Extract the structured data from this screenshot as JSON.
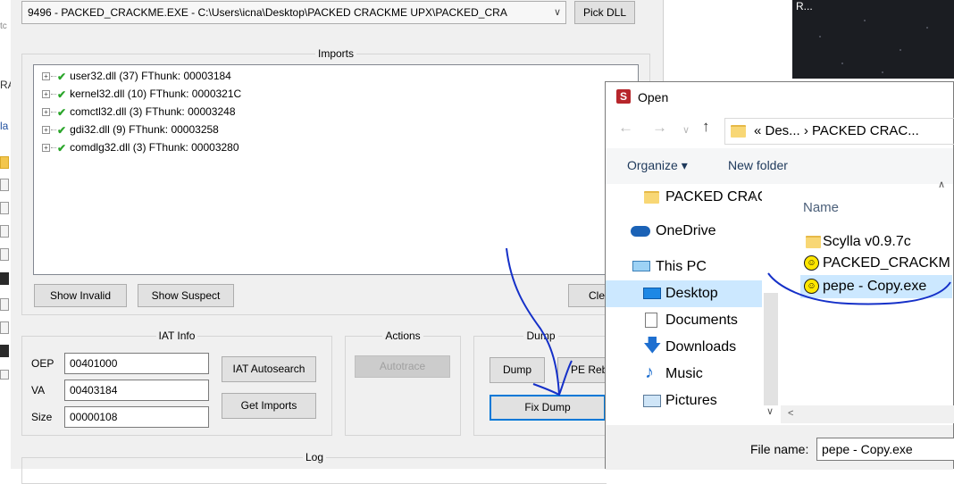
{
  "background_window": {
    "fragments": [
      "tc",
      "RA",
      "la"
    ]
  },
  "scylla": {
    "process_select_value": "9496 - PACKED_CRACKME.EXE - C:\\Users\\icna\\Desktop\\PACKED CRACKME UPX\\PACKED_CRA",
    "pick_dll_label": "Pick DLL",
    "imports_title": "Imports",
    "imports": [
      {
        "name": "user32.dll (37) FThunk: 00003184"
      },
      {
        "name": "kernel32.dll (10) FThunk: 0000321C"
      },
      {
        "name": "comctl32.dll (3) FThunk: 00003248"
      },
      {
        "name": "gdi32.dll (9) FThunk: 00003258"
      },
      {
        "name": "comdlg32.dll (3) FThunk: 00003280"
      }
    ],
    "show_invalid_label": "Show Invalid",
    "show_suspect_label": "Show Suspect",
    "clear_label": "Cle",
    "iat_info_title": "IAT Info",
    "oep_label": "OEP",
    "oep_value": "00401000",
    "va_label": "VA",
    "va_value": "00403184",
    "size_label": "Size",
    "size_value": "00000108",
    "iat_autosearch_label": "IAT Autosearch",
    "get_imports_label": "Get Imports",
    "actions_title": "Actions",
    "autotrace_label": "Autotrace",
    "dump_title": "Dump",
    "dump_label": "Dump",
    "pe_rebuild_label": "PE Reb",
    "fix_dump_label": "Fix Dump",
    "log_title": "Log"
  },
  "desktop_corner": {
    "text": "R..."
  },
  "open_dialog": {
    "icon_letter": "S",
    "title": "Open",
    "breadcrumb": "« Des... › PACKED CRAC...",
    "organize_label": "Organize ▾",
    "new_folder_label": "New folder",
    "nav_items": [
      {
        "label": "PACKED CRAC",
        "icon": "folder-icon"
      },
      {
        "label": "OneDrive",
        "icon": "cloud-icon"
      },
      {
        "label": "This PC",
        "icon": "computer-icon"
      },
      {
        "label": "Desktop",
        "icon": "desktop-icon"
      },
      {
        "label": "Documents",
        "icon": "document-icon"
      },
      {
        "label": "Downloads",
        "icon": "download-icon"
      },
      {
        "label": "Music",
        "icon": "music-icon"
      },
      {
        "label": "Pictures",
        "icon": "pictures-icon"
      }
    ],
    "column_name": "Name",
    "files": [
      {
        "label": "Scylla v0.9.7c",
        "icon": "folder-icon"
      },
      {
        "label": "PACKED_CRACKM",
        "icon": "smiley-exe-icon"
      },
      {
        "label": "pepe - Copy.exe",
        "icon": "smiley-exe-icon"
      }
    ],
    "filename_label": "File name:",
    "filename_value": "pepe - Copy.exe"
  },
  "colors": {
    "annotation_ink": "#1530c8",
    "selection": "#cce8ff",
    "window_bg": "#f0f0f0"
  }
}
